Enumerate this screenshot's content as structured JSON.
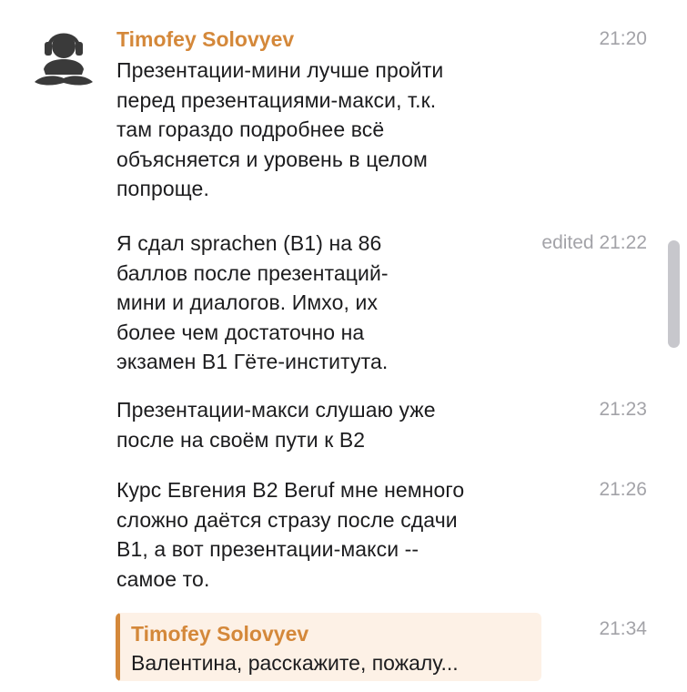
{
  "messages": [
    {
      "sender": "Timofey Solovyev",
      "text": "Презентации-мини лучше пройти\nперед презентациями-макси, т.к.\nтам гораздо подробнее всё\nобъясняется и уровень в целом\nпопроще.",
      "time": "21:20"
    },
    {
      "text": "Я сдал sprachen (B1) на 86\nбаллов после презентаций-\nмини и диалогов. Имхо, их\nболее чем достаточно на\nэкзамен B1 Гёте-института.",
      "time": "edited 21:22"
    },
    {
      "text": "Презентации-макси слушаю уже\nпосле на своём пути к B2",
      "time": "21:23"
    },
    {
      "text": "Курс Евгения B2 Beruf мне немного\nсложно даётся стразу после сдачи\nB1, а вот презентации-макси --\nсамое то.",
      "time": "21:26"
    },
    {
      "reply": {
        "sender": "Timofey Solovyev",
        "text": "Валентина, расскажите, пожалу..."
      },
      "time": "21:34"
    }
  ],
  "colors": {
    "sender": "#d4883a",
    "text": "#1c1c1e",
    "time": "#a3a3a8",
    "reply_background": "#fdf1e6",
    "scrollbar": "#c7c7cc"
  },
  "icons": {
    "avatar": "headphones-person-icon"
  }
}
